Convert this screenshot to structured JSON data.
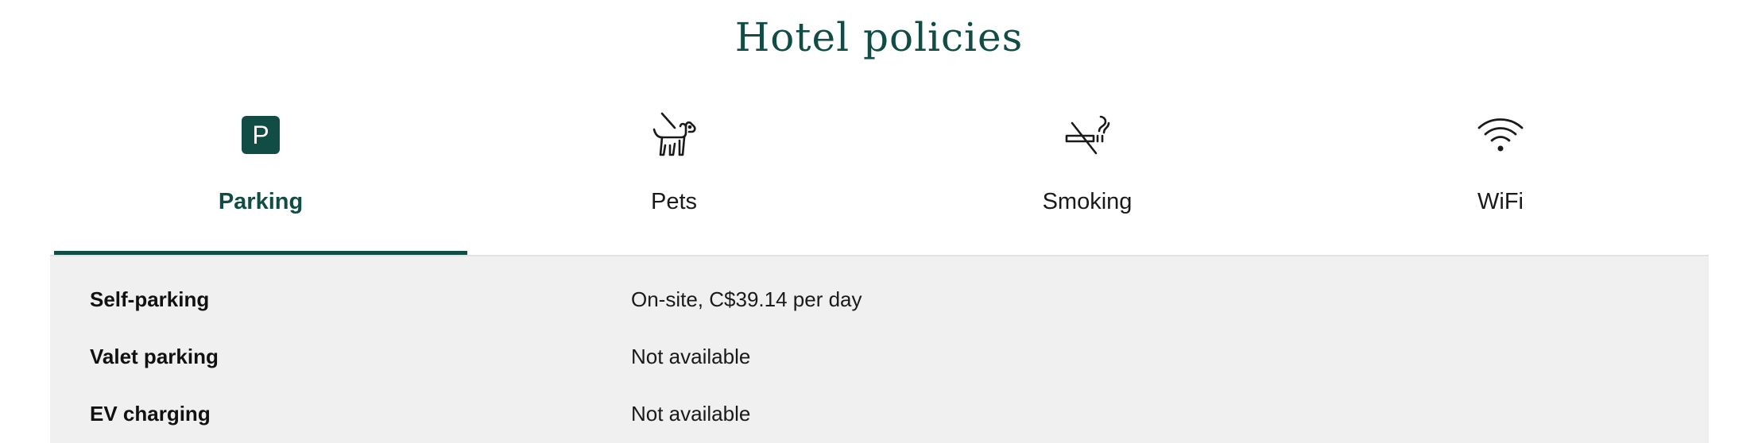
{
  "page": {
    "title": "Hotel policies"
  },
  "tabs": [
    {
      "label": "Parking",
      "icon": "parking-icon",
      "active": true
    },
    {
      "label": "Pets",
      "icon": "dog-on-leash-icon",
      "active": false
    },
    {
      "label": "Smoking",
      "icon": "no-smoking-icon",
      "active": false
    },
    {
      "label": "WiFi",
      "icon": "wifi-icon",
      "active": false
    }
  ],
  "parking_details": [
    {
      "name": "Self-parking",
      "value": "On-site, C$39.14 per day"
    },
    {
      "name": "Valet parking",
      "value": "Not available"
    },
    {
      "name": "EV charging",
      "value": "Not available"
    }
  ],
  "colors": {
    "accent": "#124d45",
    "panel_bg": "#f0f0f0"
  },
  "icons": {
    "parking_letter": "P"
  }
}
